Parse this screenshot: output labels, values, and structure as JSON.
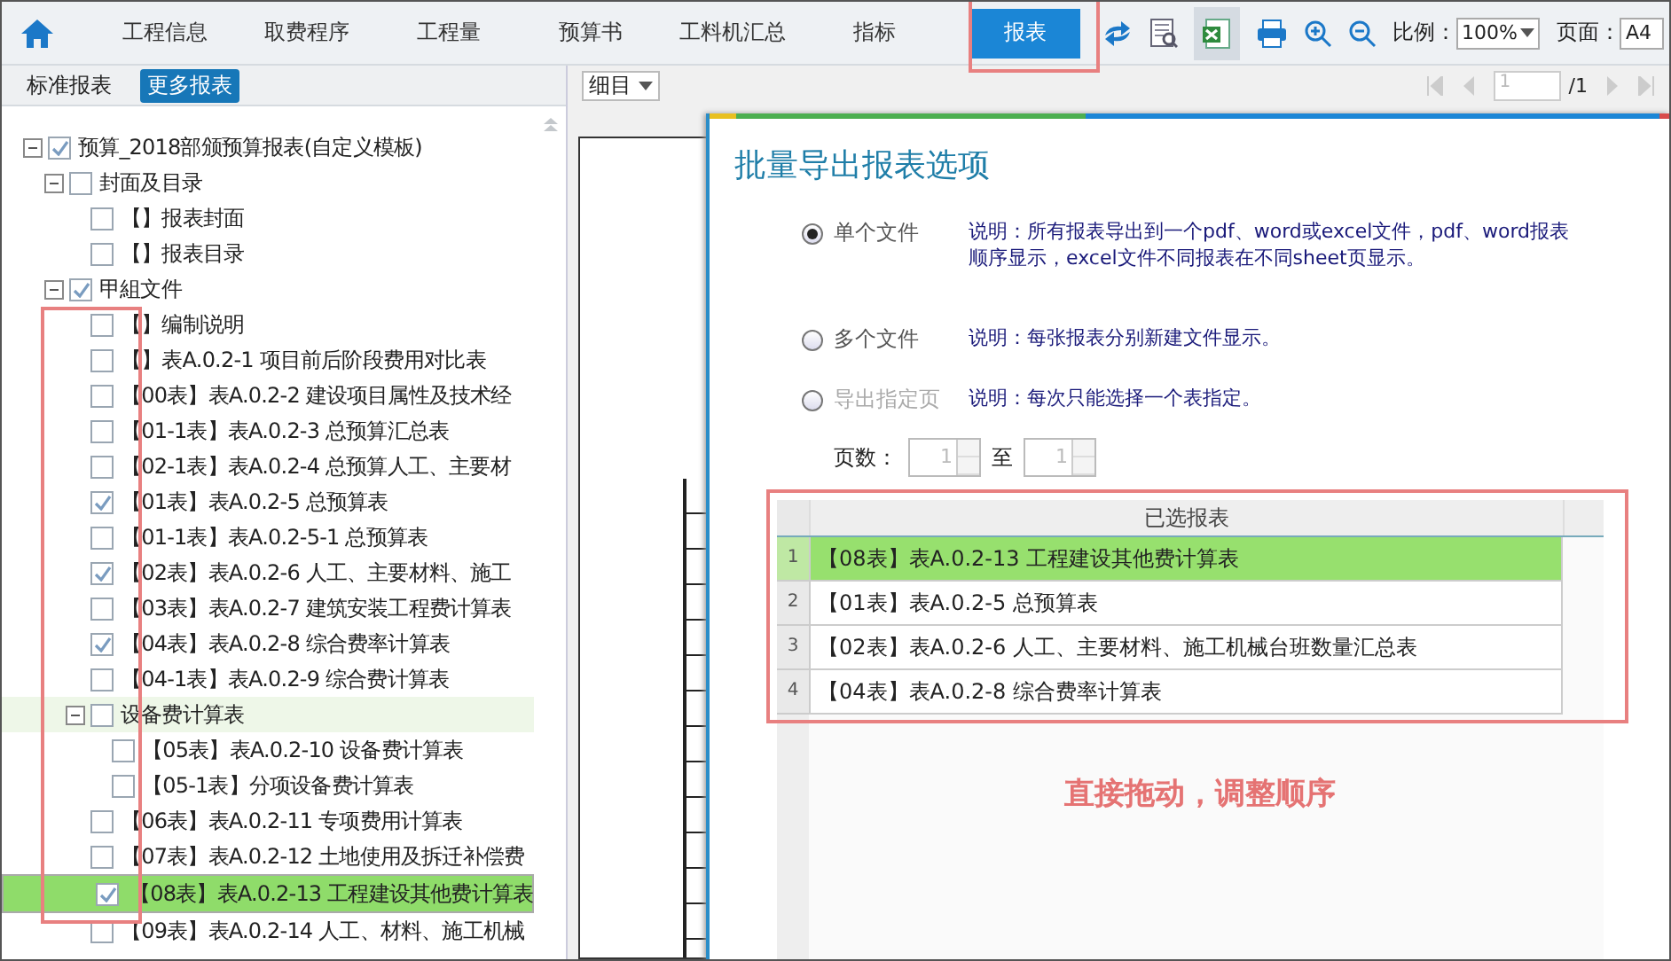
{
  "tabs": [
    {
      "label": "工程信息",
      "selected": false
    },
    {
      "label": "取费程序",
      "selected": false
    },
    {
      "label": "工程量",
      "selected": false
    },
    {
      "label": "预算书",
      "selected": false
    },
    {
      "label": "工料机汇总",
      "selected": false
    },
    {
      "label": "指标",
      "selected": false
    },
    {
      "label": "报表",
      "selected": true
    }
  ],
  "toolbar": {
    "scale_label": "比例：",
    "scale_value": "100%",
    "page_label": "页面：",
    "page_value": "A4"
  },
  "sidebar": {
    "title": "标准报表",
    "more_button": "更多报表",
    "tree": [
      {
        "kind": "group",
        "label": "预算_2018部颁预算报表(自定义模板)",
        "checked": true,
        "expanded": true,
        "selected": false,
        "highlighted": false,
        "children": [
          {
            "kind": "group",
            "label": "封面及目录",
            "checked": false,
            "expanded": true,
            "selected": false,
            "highlighted": false,
            "children": [
              {
                "kind": "leaf",
                "label": "【】报表封面",
                "checked": false,
                "selected": false,
                "highlighted": false
              },
              {
                "kind": "leaf",
                "label": "【】报表目录",
                "checked": false,
                "selected": false,
                "highlighted": false
              }
            ]
          },
          {
            "kind": "group",
            "label": "甲組文件",
            "checked": true,
            "expanded": true,
            "selected": false,
            "highlighted": false,
            "children": [
              {
                "kind": "leaf",
                "label": "【】编制说明",
                "checked": false,
                "selected": false,
                "highlighted": false
              },
              {
                "kind": "leaf",
                "label": "【】表A.0.2-1 项目前后阶段费用对比表",
                "checked": false,
                "selected": false,
                "highlighted": false
              },
              {
                "kind": "leaf",
                "label": "【00表】表A.0.2-2 建设项目属性及技术经",
                "checked": false,
                "selected": false,
                "highlighted": false
              },
              {
                "kind": "leaf",
                "label": "【01-1表】表A.0.2-3 总预算汇总表",
                "checked": false,
                "selected": false,
                "highlighted": false
              },
              {
                "kind": "leaf",
                "label": "【02-1表】表A.0.2-4 总预算人工、主要材",
                "checked": false,
                "selected": false,
                "highlighted": false
              },
              {
                "kind": "leaf",
                "label": "【01表】表A.0.2-5 总预算表",
                "checked": true,
                "selected": false,
                "highlighted": false
              },
              {
                "kind": "leaf",
                "label": "【01-1表】表A.0.2-5-1 总预算表",
                "checked": false,
                "selected": false,
                "highlighted": false
              },
              {
                "kind": "leaf",
                "label": "【02表】表A.0.2-6 人工、主要材料、施工",
                "checked": true,
                "selected": false,
                "highlighted": false
              },
              {
                "kind": "leaf",
                "label": "【03表】表A.0.2-7 建筑安装工程费计算表",
                "checked": false,
                "selected": false,
                "highlighted": false
              },
              {
                "kind": "leaf",
                "label": "【04表】表A.0.2-8 综合费率计算表",
                "checked": true,
                "selected": false,
                "highlighted": false
              },
              {
                "kind": "leaf",
                "label": "【04-1表】表A.0.2-9 综合费计算表",
                "checked": false,
                "selected": false,
                "highlighted": false
              },
              {
                "kind": "group",
                "label": "设备费计算表",
                "checked": false,
                "expanded": true,
                "selected": false,
                "highlighted": true,
                "children": [
                  {
                    "kind": "leaf",
                    "label": "【05表】表A.0.2-10 设备费计算表",
                    "checked": false,
                    "selected": false,
                    "highlighted": false
                  },
                  {
                    "kind": "leaf",
                    "label": "【05-1表】分项设备费计算表",
                    "checked": false,
                    "selected": false,
                    "highlighted": false
                  }
                ]
              },
              {
                "kind": "leaf",
                "label": "【06表】表A.0.2-11 专项费用计算表",
                "checked": false,
                "selected": false,
                "highlighted": false
              },
              {
                "kind": "leaf",
                "label": "【07表】表A.0.2-12 土地使用及拆迁补偿费",
                "checked": false,
                "selected": false,
                "highlighted": false
              },
              {
                "kind": "leaf",
                "label": "【08表】表A.0.2-13 工程建设其他费计算表",
                "checked": true,
                "selected": true,
                "highlighted": false
              },
              {
                "kind": "leaf",
                "label": "【09表】表A.0.2-14 人工、材料、施工机械",
                "checked": false,
                "selected": false,
                "highlighted": false
              }
            ]
          }
        ]
      }
    ]
  },
  "preview": {
    "view_select": "细目",
    "page_input": "1",
    "page_total": "/1"
  },
  "dialog": {
    "title": "批量导出报表选项",
    "options": [
      {
        "label": "单个文件",
        "selected": true,
        "disabled": false,
        "description": "说明：所有报表导出到一个pdf、word或excel文件，pdf、word报表顺序显示，excel文件不同报表在不同sheet页显示。"
      },
      {
        "label": "多个文件",
        "selected": false,
        "disabled": false,
        "description": "说明：每张报表分别新建文件显示。"
      },
      {
        "label": "导出指定页",
        "selected": false,
        "disabled": true,
        "description": "说明：每次只能选择一个表指定。"
      }
    ],
    "page_range": {
      "label": "页数：",
      "from": "1",
      "separator": "至",
      "to": "1",
      "disabled": true
    },
    "table": {
      "column": "已选报表",
      "rows": [
        {
          "index": "1",
          "name": "【08表】表A.0.2-13 工程建设其他费计算表",
          "selected": true
        },
        {
          "index": "2",
          "name": "【01表】表A.0.2-5 总预算表",
          "selected": false
        },
        {
          "index": "3",
          "name": "【02表】表A.0.2-6 人工、主要材料、施工机械台班数量汇总表",
          "selected": false
        },
        {
          "index": "4",
          "name": "【04表】表A.0.2-8 综合费率计算表",
          "selected": false
        }
      ]
    },
    "annotation": "直接拖动，调整顺序"
  }
}
